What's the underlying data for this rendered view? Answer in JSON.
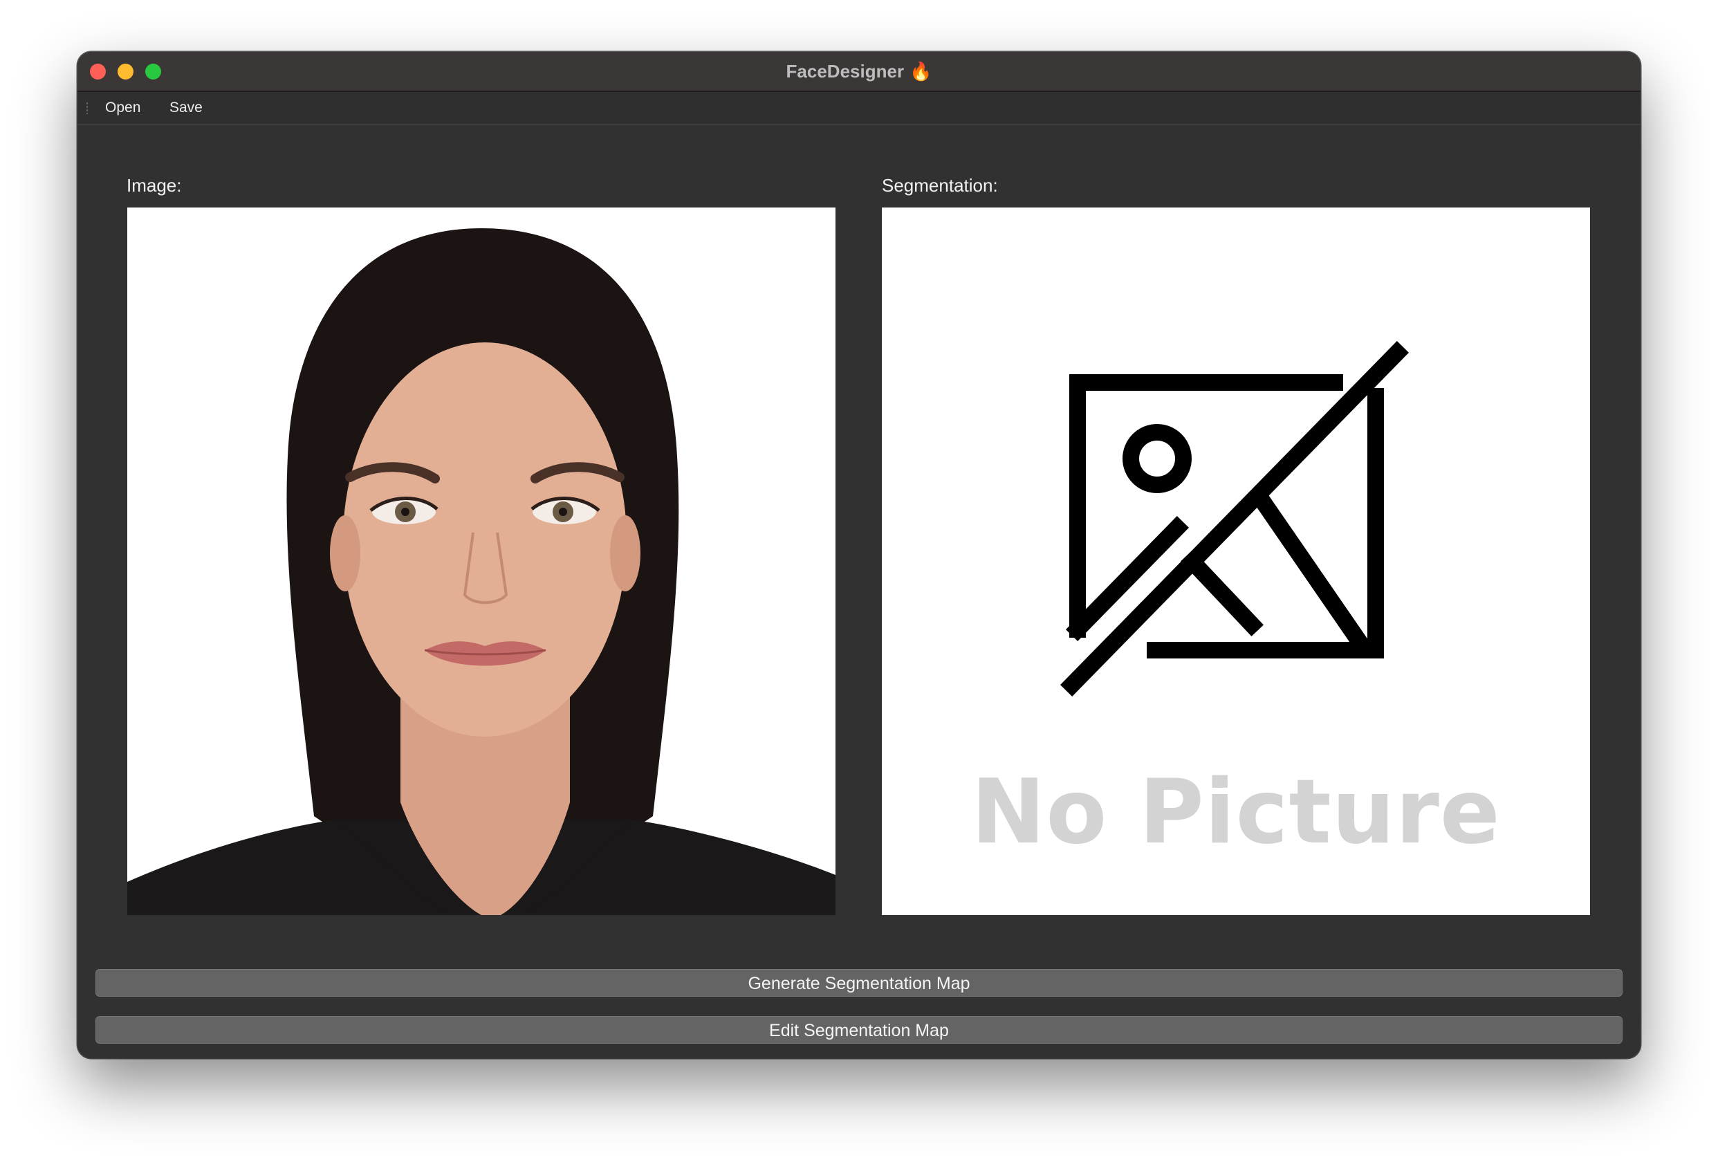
{
  "window": {
    "title": "FaceDesigner",
    "title_emoji": "🔥"
  },
  "menu": {
    "items": [
      "Open",
      "Save"
    ]
  },
  "image_panel": {
    "label": "Image:"
  },
  "segmentation_panel": {
    "label": "Segmentation:",
    "placeholder_text": "No Picture",
    "placeholder_icon": "no-image-icon"
  },
  "buttons": {
    "generate": "Generate Segmentation Map",
    "edit": "Edit Segmentation Map"
  },
  "colors": {
    "window_bg": "#313131",
    "titlebar_bg": "#3a3736",
    "button_bg": "#646464",
    "close": "#fe5f57",
    "minimize": "#febc2e",
    "maximize": "#28c840"
  }
}
